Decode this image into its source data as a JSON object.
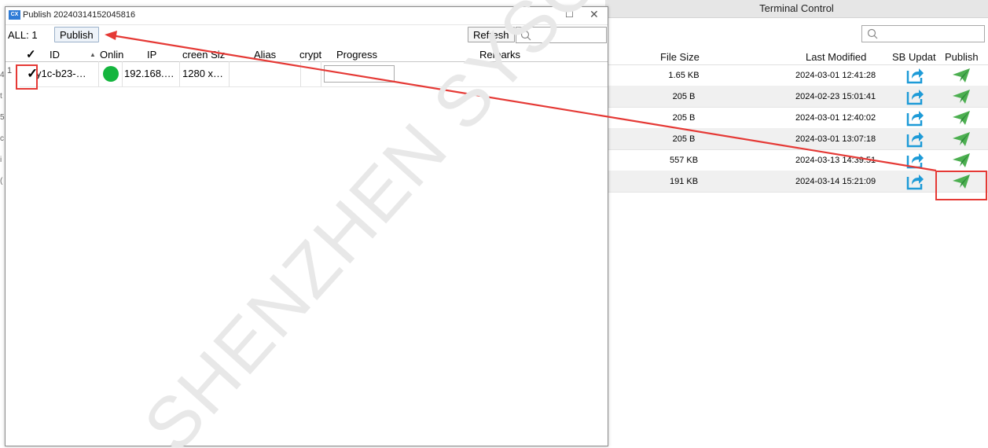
{
  "background": {
    "title": "Terminal Control",
    "search_placeholder": "",
    "columns": [
      "File Size",
      "Last Modified",
      "SB Updat",
      "Publish"
    ],
    "rows": [
      {
        "size": "1.65 KB",
        "modified": "2024-03-01 12:41:28"
      },
      {
        "size": "205 B",
        "modified": "2024-02-23 15:01:41"
      },
      {
        "size": "205 B",
        "modified": "2024-03-01 12:40:02"
      },
      {
        "size": "205 B",
        "modified": "2024-03-01 13:07:18"
      },
      {
        "size": "557 KB",
        "modified": "2024-03-13 14:39:51"
      },
      {
        "size": "191 KB",
        "modified": "2024-03-14 15:21:09"
      }
    ],
    "left_marks": [
      "4",
      "t",
      "5",
      "c",
      "i",
      "("
    ]
  },
  "dialog": {
    "app_icon_text": "CX",
    "title": "Publish 20240314152045816",
    "maximize_glyph": "☐",
    "close_glyph": "✕",
    "toolbar": {
      "all_count": "ALL: 1",
      "publish_label": "Publish",
      "refresh_label": "Refresh",
      "search_placeholder": ""
    },
    "columns": {
      "check": "✓",
      "id": "ID",
      "sort_glyph": "▲",
      "online": "Onlin",
      "ip": "IP",
      "screen_size": "creen Siz",
      "alias": "Alias",
      "encrypt": "crypt",
      "progress": "Progress",
      "remarks": "Remarks"
    },
    "row": {
      "index": "1",
      "checked": "✓",
      "id": "y1c-b23-…",
      "online": true,
      "ip": "192.168.…",
      "screen_size": "1280 x…",
      "alias": "",
      "encrypt": "",
      "progress": 0,
      "remarks": ""
    }
  },
  "watermark": {
    "text": "SHENZHEN SYSOLUTION TECHNOLOGY",
    "color": "#e8e8e8"
  },
  "colors": {
    "annotation": "#e53935",
    "online": "#14b53e",
    "update_icon": "#1e9bd7",
    "publish_icon": "#4caf50"
  }
}
